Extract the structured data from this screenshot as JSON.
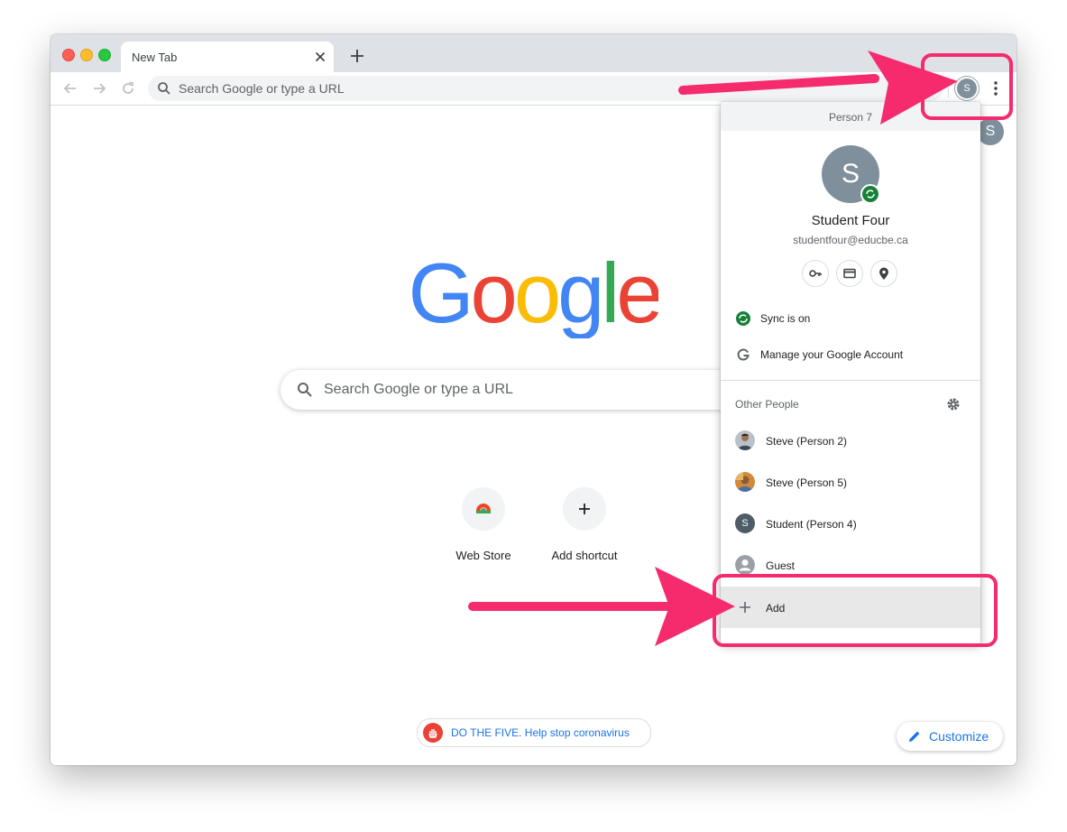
{
  "browser": {
    "tab_title": "New Tab",
    "omnibox_placeholder": "Search Google or type a URL",
    "profile_initial": "S"
  },
  "ntp": {
    "logo_letters": [
      "G",
      "o",
      "o",
      "g",
      "l",
      "e"
    ],
    "logo_colors": [
      "#4285F4",
      "#EA4335",
      "#FBBC05",
      "#4285F4",
      "#34A853",
      "#EA4335"
    ],
    "search_placeholder": "Search Google or type a URL",
    "avatar_initial": "S",
    "shortcuts": [
      {
        "label": "Web Store",
        "icon": "chrome-web-store-icon"
      },
      {
        "label": "Add shortcut",
        "icon": "plus-icon"
      }
    ],
    "promo_text": "DO THE FIVE. Help stop coronavirus",
    "customize_label": "Customize"
  },
  "profile_menu": {
    "header": "Person 7",
    "avatar_initial": "S",
    "name": "Student Four",
    "email": "studentfour@educbe.ca",
    "quick_icons": [
      "key-icon",
      "credit-card-icon",
      "location-pin-icon"
    ],
    "sync_label": "Sync is on",
    "manage_label": "Manage your Google Account",
    "other_people_title": "Other People",
    "people": [
      {
        "label": "Steve (Person 2)",
        "icon": "avatar-photo-icon"
      },
      {
        "label": "Steve (Person 5)",
        "icon": "avatar-photo-icon"
      },
      {
        "label": "Student (Person 4)",
        "icon": "avatar-initial-icon",
        "initial": "S"
      },
      {
        "label": "Guest",
        "icon": "guest-icon"
      }
    ],
    "add_label": "Add"
  },
  "colors": {
    "annotation": "#f52b6e",
    "link_blue": "#1a73e8",
    "sync_green": "#188038",
    "avatar_gray": "#7f909c"
  }
}
